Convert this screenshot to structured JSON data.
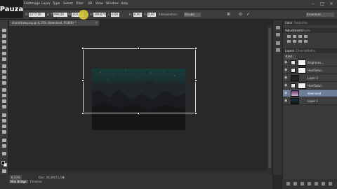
{
  "app": {
    "logo_text": "Pauza"
  },
  "menu": [
    "Edit",
    "Image",
    "Layer",
    "Type",
    "Select",
    "Filter",
    "3D",
    "View",
    "Window",
    "Help"
  ],
  "options": {
    "x_label": "X:",
    "x_value": "2277,50 px",
    "y_label": "Y:",
    "y_value": "999,50 px",
    "w_label": "W:",
    "w_value": "110,29%",
    "h_label": "H:",
    "h_value": "109,67%",
    "angle_value": "0,00",
    "h_skew_label": "H:",
    "h_skew_value": "0,00",
    "v_skew_label": "V:",
    "v_skew_value": "0,00",
    "interp_label": "Interpolation:",
    "interp_value": "Bicubic",
    "workspace": "Essentials"
  },
  "document": {
    "tab_title": "sharkshow.png @ 8,33% (download, RGB/8) *",
    "close": "×"
  },
  "status": {
    "zoom": "8,33%",
    "doc": "Doc: 26,4M/73,2M"
  },
  "bottom_tabs": [
    "Mini Bridge",
    "Timeline"
  ],
  "panels": {
    "top_tabs": [
      "Color",
      "Swatches"
    ],
    "mid_tabs": [
      "Adjustments",
      "Styles"
    ],
    "layer_tabs": [
      "Layers",
      "Channels",
      "Paths"
    ],
    "kind_value": "Kind",
    "blend_mode": "Normal",
    "opacity_label": "Opacity:",
    "opacity_value": "100%",
    "lock_label": "Lock:",
    "fill_label": "Fill:",
    "fill_value": "100%"
  },
  "layers": [
    {
      "name": "Brightnes...",
      "type": "adjustment",
      "selected": false
    },
    {
      "name": "Hue/Satur...",
      "type": "adjustment",
      "selected": false
    },
    {
      "name": "Layer 2",
      "type": "image",
      "selected": false
    },
    {
      "name": "Hue/Satur...",
      "type": "adjustment",
      "selected": false
    },
    {
      "name": "download",
      "type": "image",
      "selected": true
    },
    {
      "name": "Layer 1",
      "type": "image",
      "selected": false
    }
  ],
  "colors": {
    "accent": "#6d7f98",
    "panel": "#3a3a3a",
    "canvas": "#282828"
  }
}
